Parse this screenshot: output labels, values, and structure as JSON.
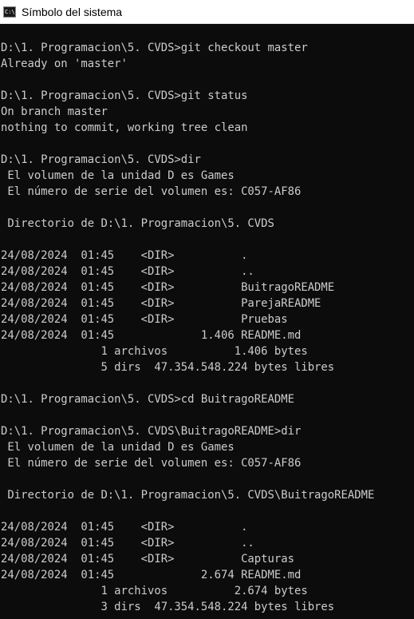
{
  "window": {
    "title": "Símbolo del sistema",
    "icon": "cmd-icon",
    "icon_glyph": "C:\\",
    "titlebar_background": "#ffffff",
    "console_background": "#0c0c0c",
    "console_text_color": "#cccccc"
  },
  "console": {
    "lines": [
      "",
      "D:\\1. Programacion\\5. CVDS>git checkout master",
      "Already on 'master'",
      "",
      "D:\\1. Programacion\\5. CVDS>git status",
      "On branch master",
      "nothing to commit, working tree clean",
      "",
      "D:\\1. Programacion\\5. CVDS>dir",
      " El volumen de la unidad D es Games",
      " El número de serie del volumen es: C057-AF86",
      "",
      " Directorio de D:\\1. Programacion\\5. CVDS",
      "",
      "24/08/2024  01:45    <DIR>          .",
      "24/08/2024  01:45    <DIR>          ..",
      "24/08/2024  01:45    <DIR>          BuitragoREADME",
      "24/08/2024  01:45    <DIR>          ParejaREADME",
      "24/08/2024  01:45    <DIR>          Pruebas",
      "24/08/2024  01:45             1.406 README.md",
      "               1 archivos          1.406 bytes",
      "               5 dirs  47.354.548.224 bytes libres",
      "",
      "D:\\1. Programacion\\5. CVDS>cd BuitragoREADME",
      "",
      "D:\\1. Programacion\\5. CVDS\\BuitragoREADME>dir",
      " El volumen de la unidad D es Games",
      " El número de serie del volumen es: C057-AF86",
      "",
      " Directorio de D:\\1. Programacion\\5. CVDS\\BuitragoREADME",
      "",
      "24/08/2024  01:45    <DIR>          .",
      "24/08/2024  01:45    <DIR>          ..",
      "24/08/2024  01:45    <DIR>          Capturas",
      "24/08/2024  01:45             2.674 README.md",
      "               1 archivos          2.674 bytes",
      "               3 dirs  47.354.548.224 bytes libres"
    ]
  }
}
